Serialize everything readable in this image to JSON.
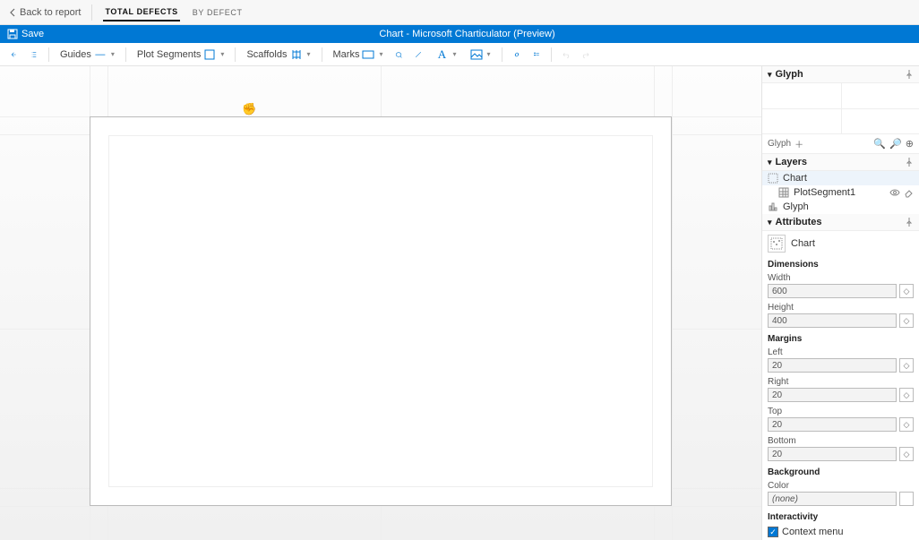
{
  "topnav": {
    "back": "Back to report",
    "tabs": [
      {
        "label": "TOTAL DEFECTS",
        "active": true
      },
      {
        "label": "BY DEFECT",
        "active": false
      }
    ]
  },
  "titlebar": {
    "save": "Save",
    "title": "Chart - Microsoft Charticulator (Preview)"
  },
  "toolbar": {
    "guides": "Guides",
    "plot_segments": "Plot Segments",
    "scaffolds": "Scaffolds",
    "marks": "Marks"
  },
  "side": {
    "glyph": {
      "title": "Glyph",
      "footer_label": "Glyph"
    },
    "layers": {
      "title": "Layers",
      "items": [
        {
          "name": "Chart",
          "selected": true,
          "icon": "chart"
        },
        {
          "name": "PlotSegment1",
          "selected": false,
          "icon": "grid",
          "indent": 1,
          "eye": true
        },
        {
          "name": "Glyph",
          "selected": false,
          "icon": "glyph"
        }
      ]
    },
    "attributes": {
      "title": "Attributes",
      "object": "Chart",
      "dimensions_title": "Dimensions",
      "width_label": "Width",
      "width_value": "600",
      "height_label": "Height",
      "height_value": "400",
      "margins_title": "Margins",
      "left_label": "Left",
      "left_value": "20",
      "right_label": "Right",
      "right_value": "20",
      "top_label": "Top",
      "top_value": "20",
      "bottom_label": "Bottom",
      "bottom_value": "20",
      "background_title": "Background",
      "color_label": "Color",
      "color_value": "(none)",
      "interactivity_title": "Interactivity",
      "context_menu": "Context menu"
    }
  }
}
